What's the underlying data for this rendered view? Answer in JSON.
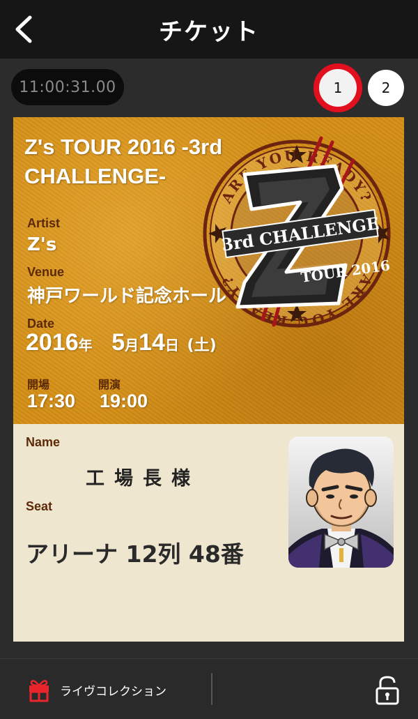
{
  "header": {
    "title": "チケット",
    "back_icon": "chevron-left-icon"
  },
  "timer": {
    "value": "11:00:31.00"
  },
  "pages": {
    "items": [
      "1",
      "2"
    ],
    "active_index": 0,
    "active_color": "#e2101e"
  },
  "ticket": {
    "title": "Z's TOUR 2016 -3rd CHALLENGE-",
    "logo": {
      "ring_text": "ARE YOU READY?",
      "badge_text": "3rd CHALLENGE",
      "tour_text": "TOUR 2016"
    },
    "artist_label": "Artist",
    "artist": "Z's",
    "venue_label": "Venue",
    "venue": "神戸ワールド記念ホール",
    "date_label": "Date",
    "date": {
      "year": "2016",
      "year_unit": "年",
      "month": "5",
      "month_unit": "月",
      "day": "14",
      "day_unit": "日",
      "weekday": "(土)"
    },
    "open_label": "開場",
    "open_time": "17:30",
    "start_label": "開演",
    "start_time": "19:00",
    "name_label": "Name",
    "name": "工場長様",
    "seat_label": "Seat",
    "seat": "アリーナ 12列 48番"
  },
  "footer": {
    "collection_label": "ライヴコレクション",
    "collection_icon": "gift-icon",
    "lock_icon": "lock-open-icon"
  },
  "colors": {
    "header_bg": "#161616",
    "ticket_orange": "#d48e14",
    "ticket_cream": "#efe6d0",
    "label_brown": "#5c2a08"
  }
}
